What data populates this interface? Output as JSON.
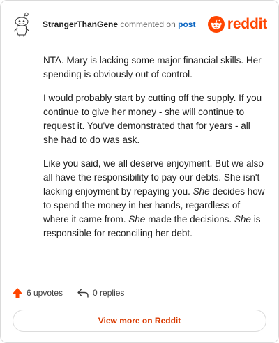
{
  "header": {
    "username": "StrangerThanGene",
    "action_text": "commented on",
    "post_link": "post",
    "brand_name": "reddit",
    "avatar_icon": "snoo-avatar-icon",
    "brand_icon": "reddit-logo-icon"
  },
  "comment": {
    "paragraphs": [
      [
        "NTA. Mary is lacking some major financial skills. Her spending is obviously out of control."
      ],
      [
        "I would probably start by cutting off the supply. If you continue to give her money - she will continue to request it. You've demonstrated that for years - all she had to do was ask."
      ],
      [
        "Like you said, we all deserve enjoyment. But we also all have the responsibility to pay our debts. She isn't lacking enjoyment by repaying you. ",
        "She",
        " decides how to spend the money in her hands, regardless of where it came from. ",
        "She",
        " made the decisions. ",
        "She",
        " is responsible for reconciling her debt."
      ]
    ]
  },
  "actions": {
    "upvotes_label": "6 upvotes",
    "replies_label": "0 replies",
    "upvote_icon": "upvote-arrow-icon",
    "reply_icon": "reply-arrow-icon"
  },
  "footer": {
    "view_more_label": "View more on Reddit"
  },
  "colors": {
    "brand": "#ff4500",
    "link": "#0a65c2",
    "view_more": "#d93a00"
  }
}
